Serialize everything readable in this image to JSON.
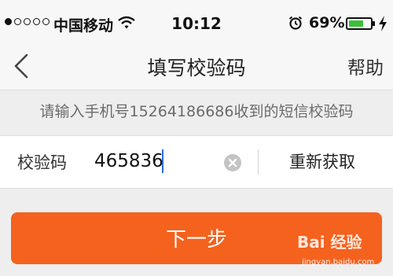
{
  "status_bar": {
    "carrier": "中国移动",
    "time": "10:12",
    "battery_percent": "69%",
    "battery_level": 0.69,
    "signal_bars_full": 1,
    "signal_bars_total": 5
  },
  "nav": {
    "title": "填写校验码",
    "help_label": "帮助"
  },
  "hint": "请输入手机号15264186686收到的短信校验码",
  "verification": {
    "label": "校验码",
    "code_value": "465836",
    "resend_label": "重新获取"
  },
  "next_button": "下一步",
  "watermark": {
    "text": "Bai 经验",
    "url": "jingyan.baidu.com"
  },
  "colors": {
    "accent": "#f4621e",
    "battery": "#3ac13a",
    "caret": "#2b6cd8"
  }
}
